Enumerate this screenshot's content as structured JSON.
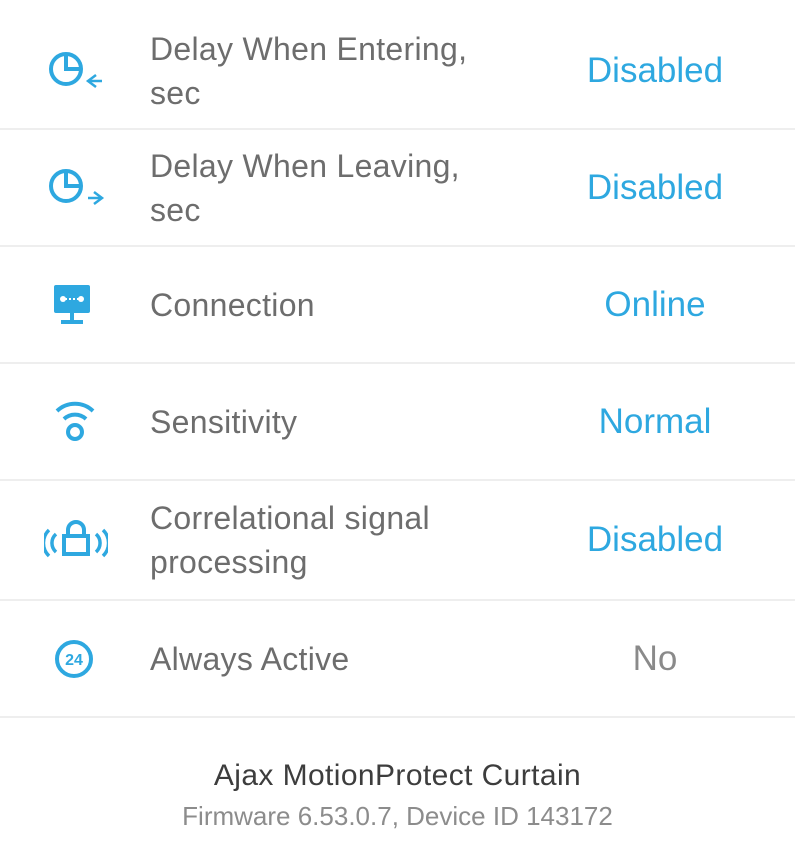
{
  "settings": {
    "rows": [
      {
        "label": "Delay When Entering, sec",
        "value": "Disabled",
        "icon": "timer-entering-icon"
      },
      {
        "label": "Delay When Leaving, sec",
        "value": "Disabled",
        "icon": "timer-leaving-icon"
      },
      {
        "label": "Connection",
        "value": "Online",
        "icon": "connection-monitor-icon"
      },
      {
        "label": "Sensitivity",
        "value": "Normal",
        "icon": "sensitivity-signal-icon"
      },
      {
        "label": "Correlational signal processing",
        "value": "Disabled",
        "icon": "correlation-lock-icon"
      },
      {
        "label": "Always Active",
        "value": "No",
        "icon": "always-active-24-icon"
      }
    ]
  },
  "device": {
    "name": "Ajax MotionProtect Curtain",
    "firmware_line": "Firmware 6.53.0.7, Device ID 143172"
  },
  "colors": {
    "accent": "#2ea8e0",
    "label": "#6d6d6d",
    "divider": "#eeeeee",
    "muted_value": "#8a8a8a"
  }
}
